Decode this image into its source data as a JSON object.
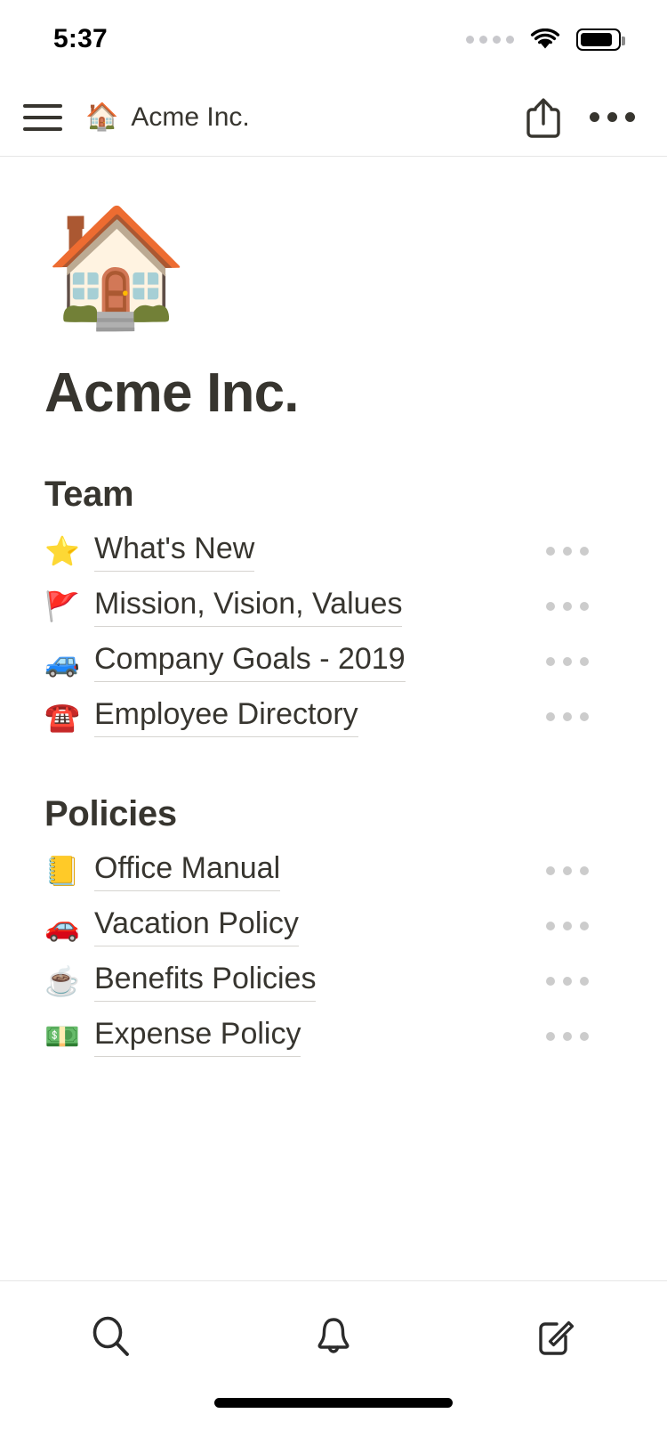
{
  "status_bar": {
    "time": "5:37",
    "signal_icon": "cellular-dots-icon",
    "wifi_icon": "wifi-icon",
    "battery_icon": "battery-icon"
  },
  "navbar": {
    "menu_icon": "hamburger-menu-icon",
    "workspace_emoji": "🏠",
    "workspace_title": "Acme Inc.",
    "share_icon": "share-icon",
    "more_icon": "more-options-icon"
  },
  "page": {
    "icon": "🏠",
    "title": "Acme Inc."
  },
  "sections": [
    {
      "title": "Team",
      "items": [
        {
          "emoji": "⭐",
          "label": "What's New",
          "menu_icon": "row-more-icon"
        },
        {
          "emoji": "🚩",
          "label": "Mission, Vision, Values",
          "menu_icon": "row-more-icon"
        },
        {
          "emoji": "🚙",
          "label": "Company Goals - 2019",
          "menu_icon": "row-more-icon"
        },
        {
          "emoji": "☎️",
          "label": "Employee Directory",
          "menu_icon": "row-more-icon"
        }
      ]
    },
    {
      "title": "Policies",
      "items": [
        {
          "emoji": "📒",
          "label": "Office Manual",
          "menu_icon": "row-more-icon"
        },
        {
          "emoji": "🚗",
          "label": "Vacation Policy",
          "menu_icon": "row-more-icon"
        },
        {
          "emoji": "☕",
          "label": "Benefits Policies",
          "menu_icon": "row-more-icon"
        },
        {
          "emoji": "💵",
          "label": "Expense Policy",
          "menu_icon": "row-more-icon"
        }
      ]
    }
  ],
  "tabbar": {
    "tabs": [
      {
        "icon": "search-icon",
        "name": "search"
      },
      {
        "icon": "bell-icon",
        "name": "notifications"
      },
      {
        "icon": "compose-icon",
        "name": "new-page"
      }
    ]
  },
  "colors": {
    "text": "#37352F",
    "divider": "#E6E6E6",
    "underline": "#D6D4D0",
    "row_menu_dot": "#CCCCCC",
    "signal_dot": "#C8C8CC"
  }
}
